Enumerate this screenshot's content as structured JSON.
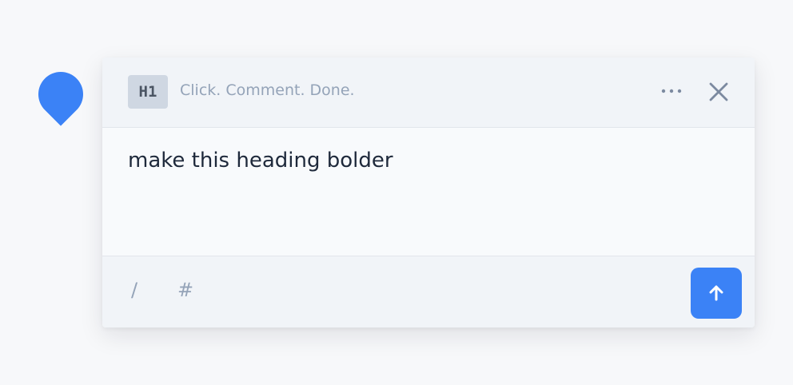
{
  "colors": {
    "accent": "#3b82f6",
    "header_bg": "#f1f4f8",
    "body_bg": "#f8fafc",
    "tag_bg": "#cfd7e2",
    "muted_text": "#94a3b8",
    "main_text": "#1e293b"
  },
  "pin": {
    "icon": "location-pin-icon"
  },
  "header": {
    "tag_label": "H1",
    "subtitle": "Click. Comment. Done.",
    "more_icon": "more-horizontal-icon",
    "close_icon": "close-icon"
  },
  "comment": {
    "text": "make this heading bolder"
  },
  "footer": {
    "commands": [
      "/",
      "#"
    ],
    "send_icon": "arrow-up-icon"
  }
}
